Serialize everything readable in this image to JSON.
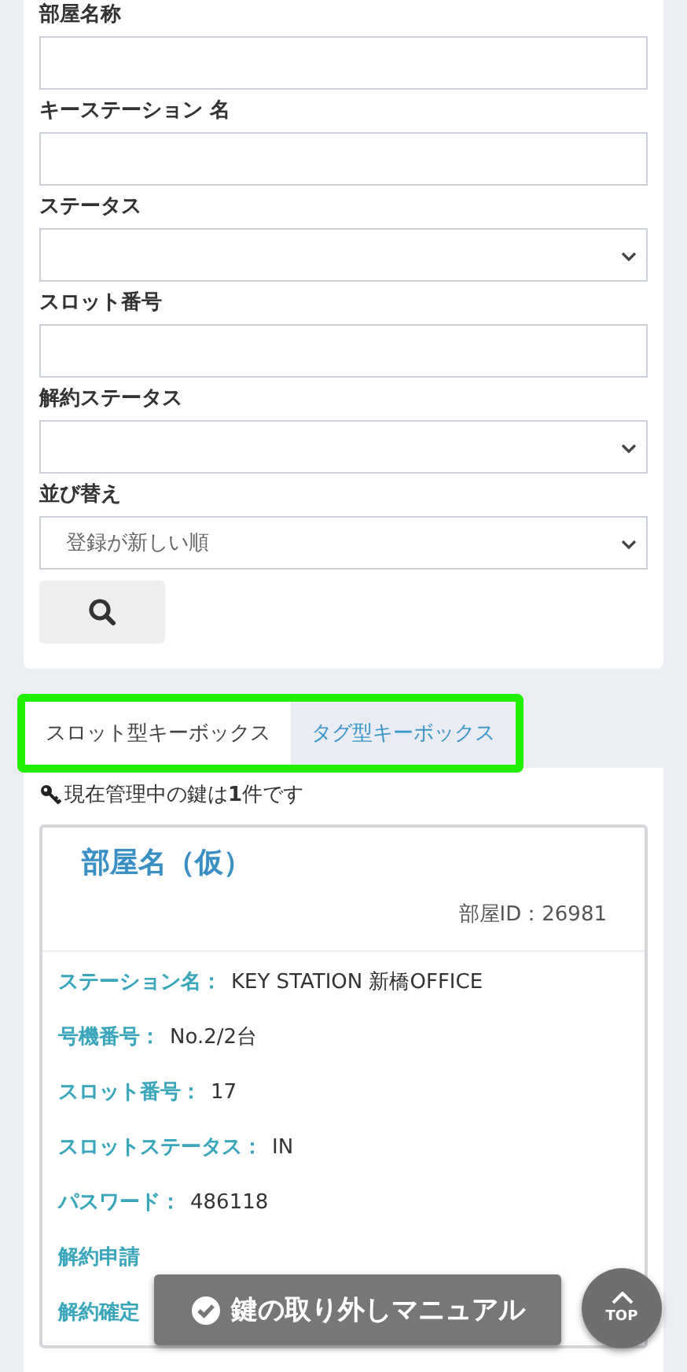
{
  "search_form": {
    "fields": [
      {
        "label": "部屋名称",
        "kind": "text"
      },
      {
        "label": "キーステーション 名",
        "kind": "text"
      },
      {
        "label": "ステータス",
        "kind": "select"
      },
      {
        "label": "スロット番号",
        "kind": "text"
      },
      {
        "label": "解約ステータス",
        "kind": "select"
      },
      {
        "label": "並び替え",
        "kind": "select",
        "value": "登録が新しい順"
      }
    ]
  },
  "tabs": [
    {
      "label": "スロット型キーボックス",
      "selected": true
    },
    {
      "label": "タグ型キーボックス",
      "selected": false
    }
  ],
  "key_count": "現在管理中の鍵は**1**件です",
  "room_card": {
    "title": "部屋名（仮）",
    "room_id": "部屋ID：26981",
    "details": [
      {
        "label": "ステーション名：",
        "value": "KEY STATION 新橋OFFICE"
      },
      {
        "label": "号機番号：",
        "value": "No.2/2台"
      },
      {
        "label": "スロット番号：",
        "value": "17"
      },
      {
        "label": "スロットステータス：",
        "value": "IN"
      },
      {
        "label": "パスワード：",
        "value": "486118"
      },
      {
        "label": "解約申請"
      },
      {
        "label": "解約確定"
      }
    ]
  },
  "manual_button": "鍵の取り外しマニュアル",
  "top_button": "TOP"
}
